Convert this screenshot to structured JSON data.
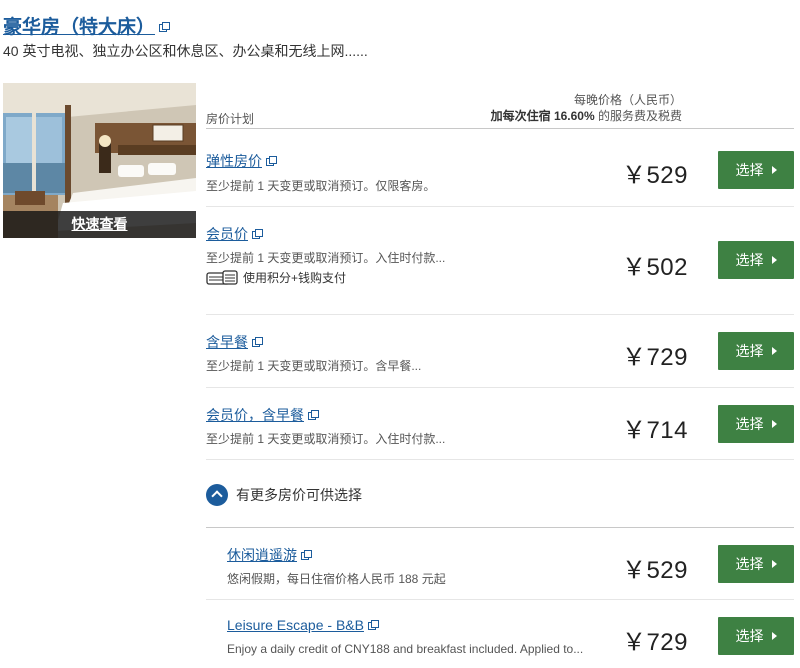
{
  "room": {
    "title": "豪华房（特大床）",
    "description": "40 英寸电视、独立办公区和休息区、办公桌和无线上网......",
    "quick_view_label": "快速查看"
  },
  "table_header": {
    "plan_label": "房价计划",
    "price_label": "每晚价格（人民币）",
    "tax_prefix": "加每次住宿",
    "tax_rate": "16.60%",
    "tax_suffix": " 的服务费及税费"
  },
  "rates": [
    {
      "name": "弹性房价",
      "desc": "至少提前 1 天变更或取消预订。仅限客房。",
      "price": "￥529",
      "button": "选择"
    },
    {
      "name": "会员价",
      "desc": "至少提前 1 天变更或取消预订。入住时付款...",
      "points": "使用积分+钱购支付",
      "price": "￥502",
      "button": "选择"
    },
    {
      "name": "含早餐",
      "desc": "至少提前 1 天变更或取消预订。含早餐...",
      "price": "￥729",
      "button": "选择"
    },
    {
      "name": "会员价，含早餐",
      "desc": "至少提前 1 天变更或取消预订。入住时付款...",
      "price": "￥714",
      "button": "选择"
    }
  ],
  "more_rates_label": "有更多房价可供选择",
  "extra_rates": [
    {
      "name": "休闲逍遥游",
      "desc": "悠闲假期，每日住宿价格人民币 188 元起",
      "price": "￥529",
      "button": "选择"
    },
    {
      "name": "Leisure Escape - B&B",
      "desc": "Enjoy a daily credit of CNY188 and breakfast included. Applied to...",
      "price": "￥729",
      "button": "选择"
    }
  ],
  "colors": {
    "link": "#1c5c9c",
    "button": "#3e8143",
    "price": "#222222"
  },
  "icons": [
    "external-link-icon",
    "chevron-right-icon",
    "chevron-up-icon",
    "points-cash-icon"
  ]
}
